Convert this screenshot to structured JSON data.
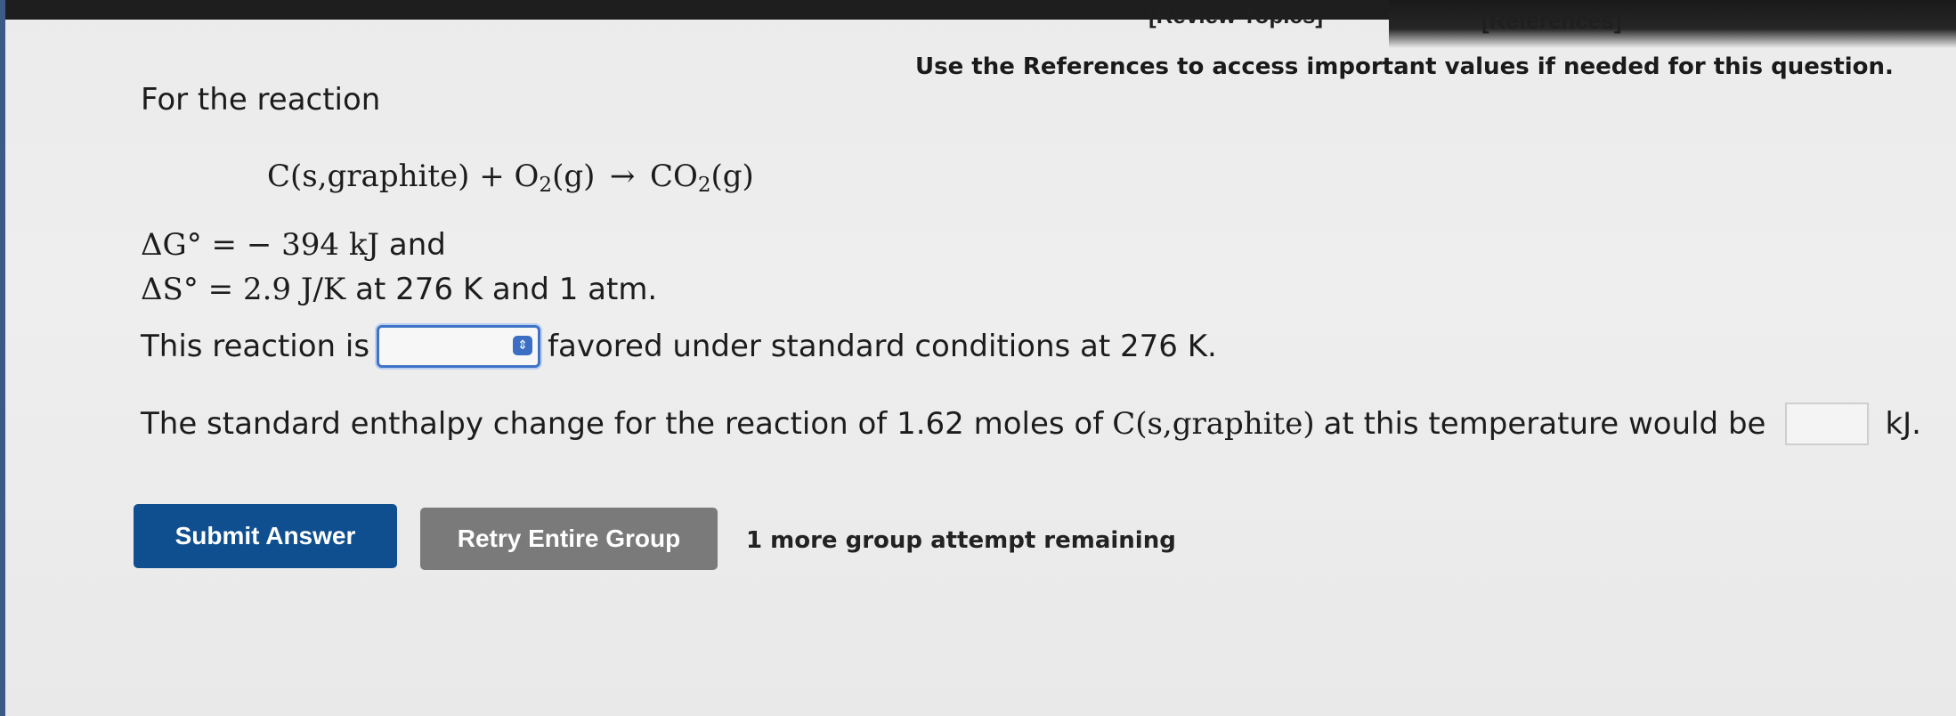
{
  "header": {
    "review_topics": "[Review Topics]",
    "references": "[References]"
  },
  "references_note": "Use the References to access important values if needed for this question.",
  "question": {
    "intro": "For the reaction",
    "equation": {
      "reactant1": "C(s,graphite)",
      "plus": "+",
      "reactant2_base": "O",
      "reactant2_sub": "2",
      "reactant2_state": "(g)",
      "arrow": "→",
      "product_base": "CO",
      "product_sub": "2",
      "product_state": "(g)"
    },
    "delta_g": {
      "symbol": "ΔG°",
      "equals": "= − 394 kJ",
      "suffix": "and"
    },
    "delta_s": {
      "symbol": "ΔS°",
      "equals": "= 2.9 J/K",
      "suffix": "at 276 K and 1 atm."
    },
    "favored": {
      "prefix": "This reaction is",
      "selected_value": "",
      "suffix": "favored under standard conditions at 276 K."
    },
    "enthalpy": {
      "prefix": "The standard enthalpy change for the reaction of 1.62 moles of",
      "species": "C(s,graphite)",
      "middle": "at this temperature would be",
      "input_value": "",
      "unit": "kJ."
    }
  },
  "actions": {
    "submit_label": "Submit Answer",
    "retry_label": "Retry Entire Group",
    "attempts_text": "1 more group attempt remaining"
  },
  "colors": {
    "submit_bg": "#0f4f8f",
    "retry_bg": "#7a7a7a",
    "select_border": "#3f73c7"
  },
  "icons": {
    "select_arrow": "up-down-chevron-icon"
  }
}
